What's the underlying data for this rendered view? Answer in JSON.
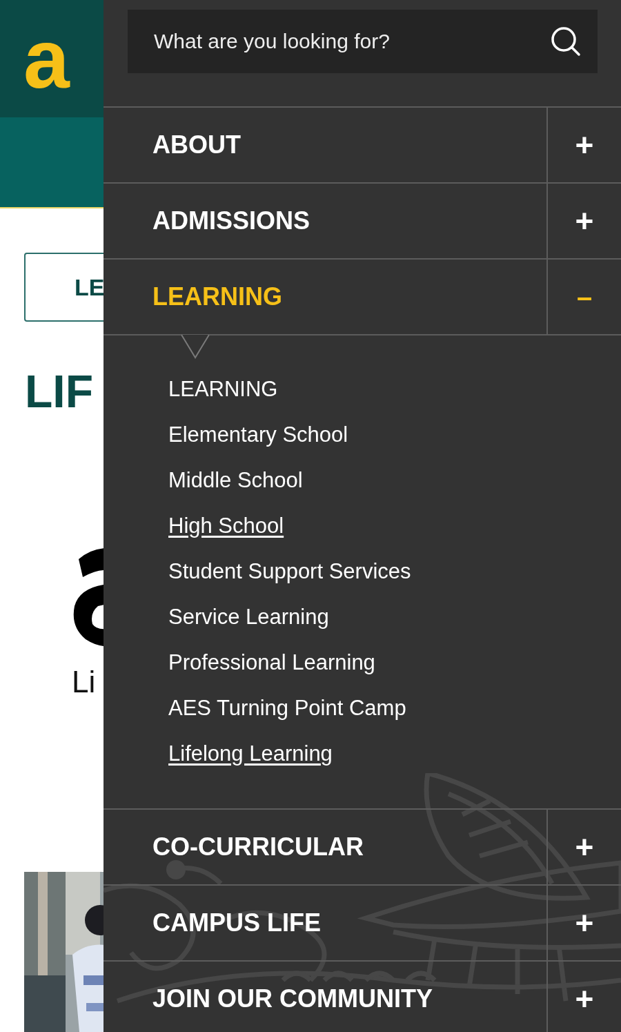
{
  "background_page": {
    "logo": "a",
    "button": "LE",
    "heading": "LIF",
    "caption": "Li"
  },
  "search": {
    "placeholder": "What are you looking for?"
  },
  "menu": [
    {
      "label": "ABOUT",
      "expanded": false,
      "toggle": "+"
    },
    {
      "label": "ADMISSIONS",
      "expanded": false,
      "toggle": "+"
    },
    {
      "label": "LEARNING",
      "expanded": true,
      "toggle": "–",
      "children": [
        {
          "label": "LEARNING",
          "underlined": false
        },
        {
          "label": "Elementary School",
          "underlined": false
        },
        {
          "label": "Middle School",
          "underlined": false
        },
        {
          "label": "High School",
          "underlined": true
        },
        {
          "label": "Student Support Services",
          "underlined": false
        },
        {
          "label": "Service Learning",
          "underlined": false
        },
        {
          "label": "Professional Learning",
          "underlined": false
        },
        {
          "label": "AES Turning Point Camp",
          "underlined": false
        },
        {
          "label": "Lifelong Learning",
          "underlined": true
        }
      ]
    },
    {
      "label": "CO-CURRICULAR",
      "expanded": false,
      "toggle": "+"
    },
    {
      "label": "CAMPUS LIFE",
      "expanded": false,
      "toggle": "+"
    },
    {
      "label": "JOIN OUR COMMUNITY",
      "expanded": false,
      "toggle": "+"
    }
  ]
}
